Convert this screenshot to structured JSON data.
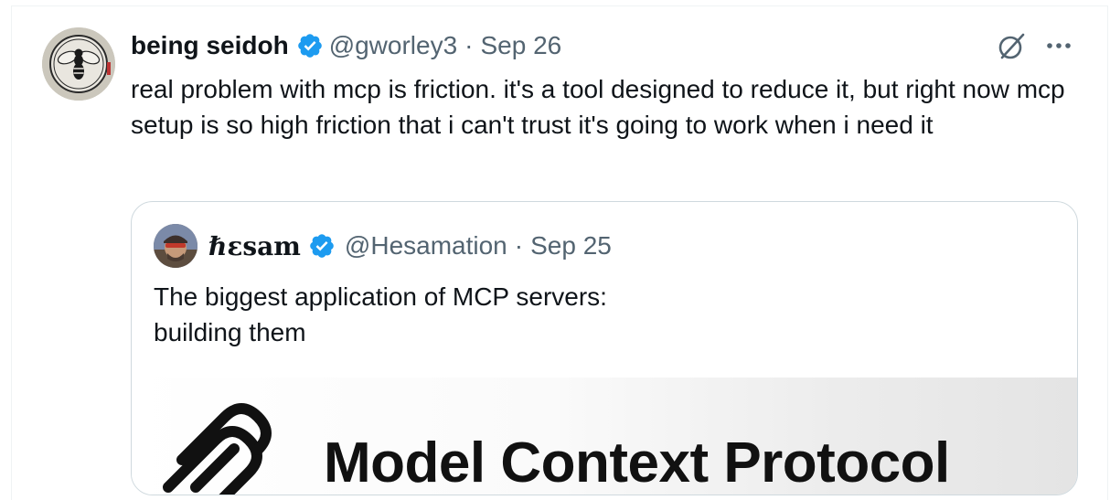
{
  "tweet": {
    "author_name": "being seidoh",
    "handle": "@gworley3",
    "separator": "·",
    "time": "Sep 26",
    "text": "real problem with mcp is friction. it's a tool designed to reduce it, but right now mcp setup is so high friction that i can't trust it's going to work when i need it"
  },
  "quoted": {
    "author_name": "ℏεsam",
    "handle": "@Hesamation",
    "separator": "·",
    "time": "Sep 25",
    "text_line1": "The biggest application of MCP servers:",
    "text_line2": "building them",
    "media_title": "Model Context Protocol"
  },
  "colors": {
    "verified": "#1d9bf0",
    "secondary_text": "#536471",
    "primary_text": "#0f1419",
    "card_border": "#cfd9de"
  },
  "icons": {
    "verified": "verified-badge-icon",
    "grok": "grok-icon",
    "more": "more-dots-icon",
    "mcp_logo": "mcp-logo-icon"
  }
}
